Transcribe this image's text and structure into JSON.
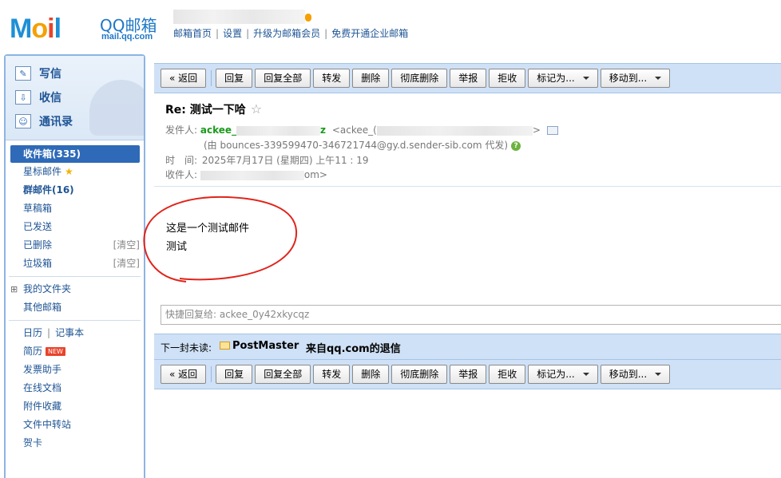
{
  "brand": {
    "logo_text": [
      "M",
      "o",
      "i",
      "l"
    ],
    "name": "QQ邮箱",
    "domain": "mail.qq.com"
  },
  "top_links": [
    "邮箱首页",
    "设置",
    "升级为邮箱会员",
    "免费开通企业邮箱"
  ],
  "quick_actions": [
    {
      "label": "写信",
      "icon": "compose-icon"
    },
    {
      "label": "收信",
      "icon": "inbox-download-icon"
    },
    {
      "label": "通讯录",
      "icon": "contacts-icon"
    }
  ],
  "folders": {
    "inbox": "收件箱(335)",
    "starred": "星标邮件",
    "group": "群邮件(16)",
    "drafts": "草稿箱",
    "sent": "已发送",
    "deleted": "已删除",
    "spam": "垃圾箱",
    "clear_label": "[清空]",
    "my_folders": "我的文件夹",
    "other_mailboxes": "其他邮箱",
    "calendar": "日历",
    "notes": "记事本",
    "resume": "简历",
    "new_badge": "NEW",
    "invoice": "发票助手",
    "docs": "在线文档",
    "attachments": "附件收藏",
    "transfer": "文件中转站",
    "cards": "贺卡"
  },
  "toolbar": {
    "back": "« 返回",
    "reply": "回复",
    "reply_all": "回复全部",
    "forward": "转发",
    "delete": "删除",
    "delete_perm": "彻底删除",
    "report": "举报",
    "reject": "拒收",
    "mark_as": "标记为...",
    "move_to": "移动到..."
  },
  "message": {
    "subject": "Re: 测试一下哈",
    "star": "☆",
    "from_label": "发件人:",
    "from_name_start": "ackee_",
    "from_name_end": "z",
    "from_addr_start": "<ackee_(",
    "from_addr_end": ">",
    "via": "(由 bounces-339599470-346721744@gy.d.sender-sib.com 代发)",
    "time_label": "时　间:",
    "time": "2025年7月17日 (星期四) 上午11 : 19",
    "to_label": "收件人:",
    "to_end": "om>",
    "body": [
      "这是一个测试邮件",
      "测试"
    ]
  },
  "quick_reply": {
    "placeholder": "快捷回复给: ackee_0y42xkycqz"
  },
  "next_unread": {
    "label": "下一封未读:",
    "sender": "PostMaster",
    "subject": "来自qq.com的退信"
  },
  "colors": {
    "accent": "#2e6ab7",
    "toolbar_bg": "#cfe1f6",
    "sender_green": "#1b9a1b",
    "annotation_red": "#e0241b"
  }
}
